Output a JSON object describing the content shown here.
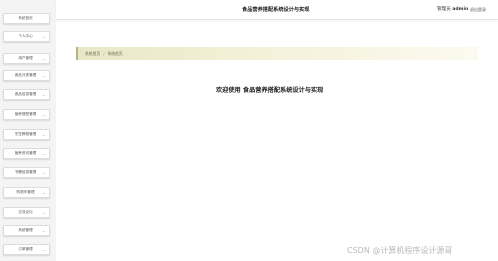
{
  "sidebar": {
    "items": [
      {
        "label": "系统首页"
      },
      {
        "label": "个人中心"
      },
      {
        "label": "用户管理"
      },
      {
        "label": "食品分类管理"
      },
      {
        "label": "食品信息管理"
      },
      {
        "label": "营养搭配管理"
      },
      {
        "label": "烹饪教程管理"
      },
      {
        "label": "营养资讯管理"
      },
      {
        "label": "书籍信息管理"
      },
      {
        "label": "购物车管理"
      },
      {
        "label": "交流论坛"
      },
      {
        "label": "系统管理"
      },
      {
        "label": "订单管理"
      }
    ]
  },
  "header": {
    "title": "食品营养搭配系统设计与实现",
    "user_role": "管理员",
    "username": "admin",
    "logout_label": "退出登录"
  },
  "breadcrumb": {
    "home": "系统首页",
    "separator": "/",
    "current": "系统首页"
  },
  "main": {
    "welcome_text": "欢迎使用 食品营养搭配系统设计与实现"
  },
  "watermark": "CSDN @计算机程序设计源哥"
}
